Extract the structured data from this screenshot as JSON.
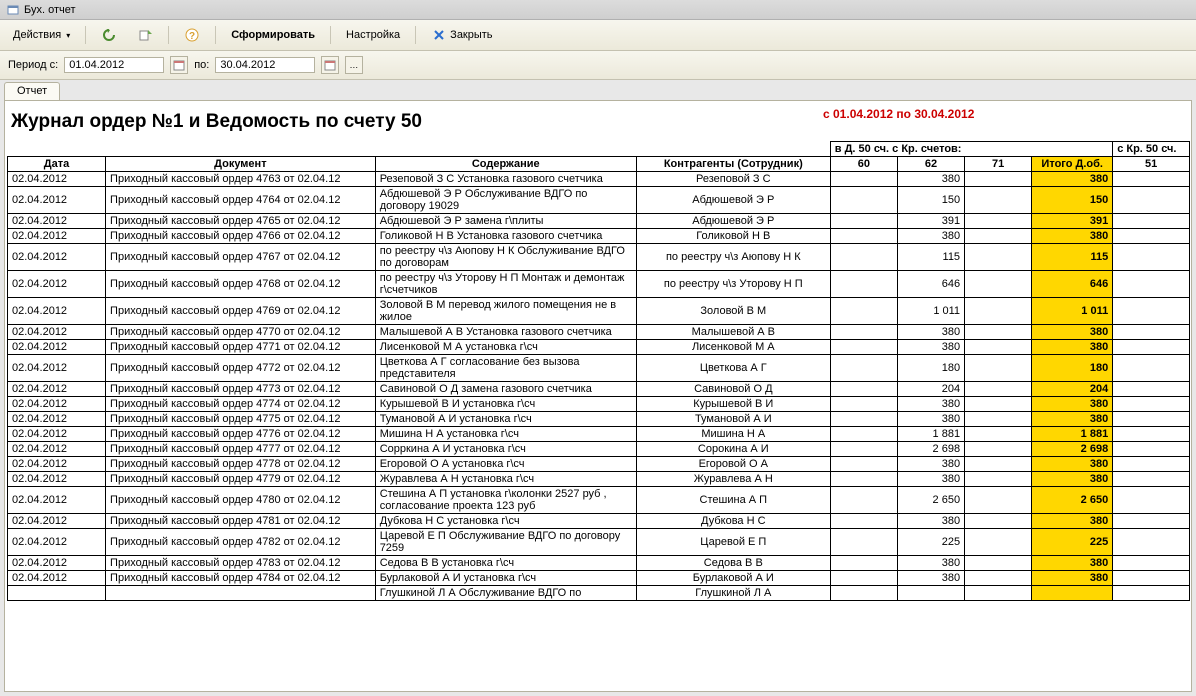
{
  "window": {
    "title": "Бух. отчет"
  },
  "toolbar": {
    "actions": "Действия",
    "form": "Сформировать",
    "settings": "Настройка",
    "close": "Закрыть"
  },
  "period": {
    "label_from": "Период с:",
    "date_from": "01.04.2012",
    "label_to": "по:",
    "date_to": "30.04.2012"
  },
  "tab": {
    "label": "Отчет"
  },
  "report": {
    "title": "Журнал ордер №1 и Ведомость по счету 50",
    "date_range": "с 01.04.2012 по 30.04.2012",
    "group_header_d": "в Д. 50 сч. с Кр. счетов:",
    "group_header_k": "с Кр. 50 сч.",
    "cols": {
      "date": "Дата",
      "doc": "Документ",
      "content": "Содержание",
      "contra": "Контрагенты (Сотрудник)",
      "a60": "60",
      "a62": "62",
      "a71": "71",
      "itog": "Итого Д.об.",
      "k51": "51"
    },
    "rows": [
      {
        "date": "02.04.2012",
        "doc": "Приходный кассовый ордер 4763 от 02.04.12",
        "content": "Резеповой З С    Установка газового счетчика",
        "contra": "Резеповой З С",
        "a62": "380",
        "itog": "380"
      },
      {
        "date": "02.04.2012",
        "doc": "Приходный кассовый ордер 4764 от 02.04.12",
        "content": "Абдюшевой  Э Р  Обслуживание ВДГО по договору 19029",
        "contra": "Абдюшевой  Э Р",
        "a62": "150",
        "itog": "150"
      },
      {
        "date": "02.04.2012",
        "doc": "Приходный кассовый ордер 4765 от 02.04.12",
        "content": "Абдюшевой  Э Р     замена г\\плиты",
        "contra": "Абдюшевой  Э Р",
        "a62": "391",
        "itog": "391"
      },
      {
        "date": "02.04.2012",
        "doc": "Приходный кассовый ордер 4766 от 02.04.12",
        "content": "Голиковой  Н В     Установка газового счетчика",
        "contra": "Голиковой  Н В",
        "a62": "380",
        "itog": "380"
      },
      {
        "date": "02.04.2012",
        "doc": "Приходный кассовый ордер 4767 от 02.04.12",
        "content": "по реестру ч\\з  Аюпову Н К   Обслуживание ВДГО по договорам",
        "contra": "по реестру ч\\з Аюпову Н К",
        "a62": "115",
        "itog": "115"
      },
      {
        "date": "02.04.2012",
        "doc": "Приходный кассовый ордер 4768 от 02.04.12",
        "content": "по реестру ч\\з  Уторову Н П  Монтаж и демонтаж г\\счетчиков",
        "contra": "по реестру ч\\з Уторову Н П",
        "a62": "646",
        "itog": "646"
      },
      {
        "date": "02.04.2012",
        "doc": "Приходный кассовый ордер 4769 от 02.04.12",
        "content": "Золовой В М   перевод жилого помещения не в жилое",
        "contra": "Золовой В М",
        "a62": "1 011",
        "itog": "1 011"
      },
      {
        "date": "02.04.2012",
        "doc": "Приходный кассовый ордер 4770 от 02.04.12",
        "content": "Малышевой  А В     Установка газового счетчика",
        "contra": "Малышевой  А В",
        "a62": "380",
        "itog": "380"
      },
      {
        "date": "02.04.2012",
        "doc": "Приходный кассовый ордер 4771 от 02.04.12",
        "content": "Лисенковой  М А  установка г\\сч",
        "contra": "Лисенковой  М А",
        "a62": "380",
        "itog": "380"
      },
      {
        "date": "02.04.2012",
        "doc": "Приходный кассовый ордер 4772 от 02.04.12",
        "content": "Цветкова  А Г   согласование без вызова представителя",
        "contra": "Цветкова  А Г",
        "a62": "180",
        "itog": "180"
      },
      {
        "date": "02.04.2012",
        "doc": "Приходный кассовый ордер 4773 от 02.04.12",
        "content": "Савиновой О Д    замена  газового счетчика",
        "contra": "Савиновой О Д",
        "a62": "204",
        "itog": "204"
      },
      {
        "date": "02.04.2012",
        "doc": "Приходный кассовый ордер 4774 от 02.04.12",
        "content": "Курышевой  В И   установка г\\сч",
        "contra": "Курышевой  В И",
        "a62": "380",
        "itog": "380"
      },
      {
        "date": "02.04.2012",
        "doc": "Приходный кассовый ордер 4775 от 02.04.12",
        "content": "Тумановой  А И   установка г\\сч",
        "contra": "Тумановой  А И",
        "a62": "380",
        "itog": "380"
      },
      {
        "date": "02.04.2012",
        "doc": "Приходный кассовый ордер 4776 от 02.04.12",
        "content": "Мишина Н А    установка г\\сч",
        "contra": "Мишина Н А",
        "a62": "1 881",
        "itog": "1 881"
      },
      {
        "date": "02.04.2012",
        "doc": "Приходный кассовый ордер 4777 от 02.04.12",
        "content": "Сорркина  А И    установка г\\сч",
        "contra": "Сорокина  А И",
        "a62": "2 698",
        "itog": "2 698"
      },
      {
        "date": "02.04.2012",
        "doc": "Приходный кассовый ордер 4778 от 02.04.12",
        "content": "Егоровой О А    установка г\\сч",
        "contra": "Егоровой О А",
        "a62": "380",
        "itog": "380"
      },
      {
        "date": "02.04.2012",
        "doc": "Приходный кассовый ордер 4779 от 02.04.12",
        "content": "Журавлева А Н  установка г\\сч",
        "contra": "Журавлева А Н",
        "a62": "380",
        "itog": "380"
      },
      {
        "date": "02.04.2012",
        "doc": "Приходный кассовый ордер 4780 от 02.04.12",
        "content": "Стешина А П установка г\\колонки  2527 руб , согласование  проекта 123 руб",
        "contra": "Стешина А П",
        "a62": "2 650",
        "itog": "2 650"
      },
      {
        "date": "02.04.2012",
        "doc": "Приходный кассовый ордер 4781 от 02.04.12",
        "content": "Дубкова Н С  установка г\\сч",
        "contra": "Дубкова Н С",
        "a62": "380",
        "itog": "380"
      },
      {
        "date": "02.04.2012",
        "doc": "Приходный кассовый ордер 4782 от 02.04.12",
        "content": "Царевой Е П  Обслуживание ВДГО по договору 7259",
        "contra": "Царевой Е П",
        "a62": "225",
        "itog": "225"
      },
      {
        "date": "02.04.2012",
        "doc": "Приходный кассовый ордер 4783 от 02.04.12",
        "content": "Седова  В В   установка г\\сч",
        "contra": "Седова  В В",
        "a62": "380",
        "itog": "380"
      },
      {
        "date": "02.04.2012",
        "doc": "Приходный кассовый ордер 4784 от 02.04.12",
        "content": "Бурлаковой  А И  установка г\\сч",
        "contra": "Бурлаковой  А И",
        "a62": "380",
        "itog": "380"
      },
      {
        "date": "",
        "doc": "",
        "content": "Глушкиной Л А  Обслуживание ВДГО по",
        "contra": "Глушкиной Л А",
        "a62": "",
        "itog": ""
      }
    ]
  }
}
